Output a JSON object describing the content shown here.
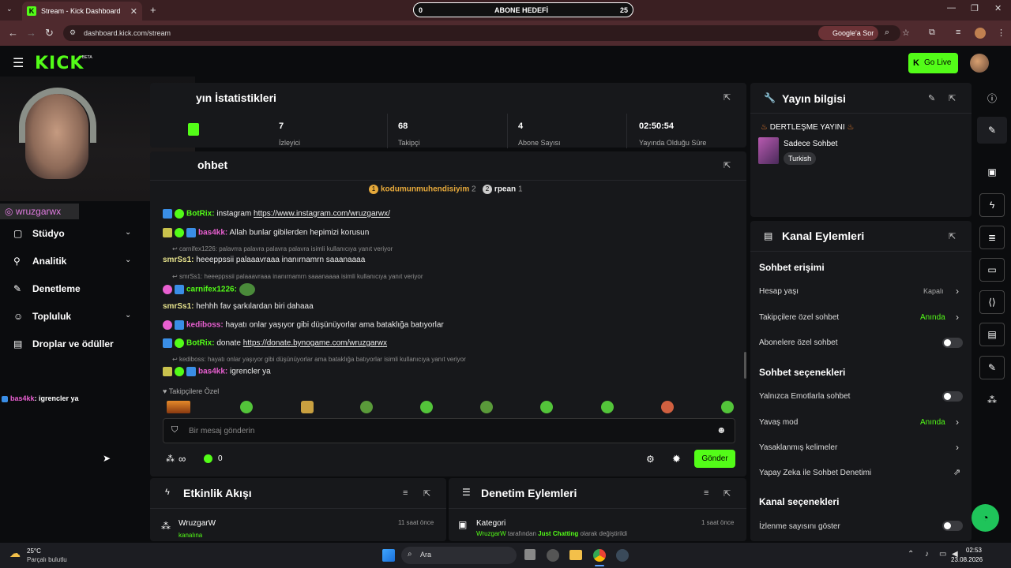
{
  "browser": {
    "tab_title": "Stream - Kick Dashboard",
    "tab_close": "✕",
    "new_tab": "+",
    "url": "dashboard.kick.com/stream",
    "google_sor": "Google'a Sor"
  },
  "goal": {
    "min": "0",
    "label": "ABONE HEDEFİ",
    "max": "25"
  },
  "topbar": {
    "logo": "KICK",
    "beta": "BETA",
    "go_live": "Go Live"
  },
  "stats": {
    "title": "yın İstatistikleri",
    "items": [
      {
        "value": "7",
        "label": "İzleyici"
      },
      {
        "value": "68",
        "label": "Takipçi"
      },
      {
        "value": "4",
        "label": "Abone Sayısı"
      },
      {
        "value": "02:50:54",
        "label": "Yayında Olduğu Süre"
      }
    ]
  },
  "chat": {
    "title": "ohbet",
    "top_gifters": [
      {
        "rank": "1",
        "name": "kodumunmuhendisiyim",
        "count": "2"
      },
      {
        "rank": "2",
        "name": "rpean",
        "count": "1"
      }
    ],
    "messages": [
      {
        "user": "BotRix:",
        "text": "instagram",
        "link": "https://www.instagram.com/wruzgarwx/"
      },
      {
        "user": "bas4kk:",
        "text": "Allah bunlar gibilerden hepimizi korusun"
      },
      {
        "reply": "carnifex1226: palavrra palavra palavra palavra isimli kullanıcıya yanıt veriyor",
        "user": "smrSs1:",
        "text": "heeeppssii palaaavraaa inanırnamrn saaanaaaa"
      },
      {
        "reply": "smrSs1: heeeppssii palaaavraaa inanırnamrn saaanaaaa isimli kullanıcıya yanıt veriyor",
        "user": "carnifex1226:"
      },
      {
        "user": "smrSs1:",
        "text": "hehhh fav şarkılardan biri dahaaa"
      },
      {
        "user": "kediboss:",
        "text": "hayatı onlar yaşıyor gibi düşünüyorlar ama bataklığa batıyorlar"
      },
      {
        "user": "BotRix:",
        "text": "donate",
        "link": "https://donate.bynogame.com/wruzgarwx"
      },
      {
        "reply": "kediboss: hayatı onlar yaşıyor gibi düşünüyorlar ama bataklığa batıyorlar isimli kullanıcıya yanıt veriyor",
        "user": "bas4kk:",
        "text": "igrencler ya"
      }
    ],
    "followers_only": "Takipçilere Özel",
    "placeholder": "Bir mesaj gönderin",
    "points": "0",
    "send": "Gönder",
    "infinity": "∞"
  },
  "overlay": {
    "instagram": "wruzgarwx",
    "chat_user": "bas4kk",
    "chat_text": ": igrencler ya"
  },
  "sidebar": {
    "items": [
      {
        "label": "Stüdyo"
      },
      {
        "label": "Analitik"
      },
      {
        "label": "Denetleme"
      },
      {
        "label": "Topluluk"
      },
      {
        "label": "Droplar ve ödüller"
      }
    ]
  },
  "stream_info": {
    "title": "Yayın bilgisi",
    "stream_title": "DERTLEŞME YAYINI",
    "category": "Sadece Sohbet",
    "language": "Turkish"
  },
  "channel_actions": {
    "title": "Kanal Eylemleri",
    "section1": "Sohbet erişimi",
    "account_age": "Hesap yaşı",
    "account_age_value": "Kapalı",
    "followers_chat": "Takipçilere özel sohbet",
    "followers_chat_value": "Anında",
    "subs_chat": "Abonelere özel sohbet",
    "section2": "Sohbet seçenekleri",
    "emote_only": "Yalnızca Emotlarla sohbet",
    "slow_mode": "Yavaş mod",
    "slow_mode_value": "Anında",
    "banned_words": "Yasaklanmış kelimeler",
    "ai_moderation": "Yapay Zeka ile Sohbet Denetimi",
    "section3": "Kanal seçenekleri",
    "view_count": "İzlenme sayısını göster"
  },
  "activity": {
    "title": "Etkinlik Akışı",
    "user": "WruzgarW",
    "time": "11 saat önce",
    "desc": "kanalına"
  },
  "moderation": {
    "title": "Denetim Eylemleri",
    "item": "Kategori",
    "time": "1 saat önce",
    "desc_user": "WruzgarW",
    "desc_mid": "tarafından",
    "desc_cat": "Just Chatting",
    "desc_end": "olarak değiştirildi"
  },
  "taskbar": {
    "temp": "25°C",
    "weather": "Parçalı bulutlu",
    "search": "Ara",
    "time": "02:53",
    "date": "23.08.2026"
  },
  "colors": {
    "accent": "#53fc18",
    "panel": "#17181b",
    "bg": "#0b0c0e"
  }
}
